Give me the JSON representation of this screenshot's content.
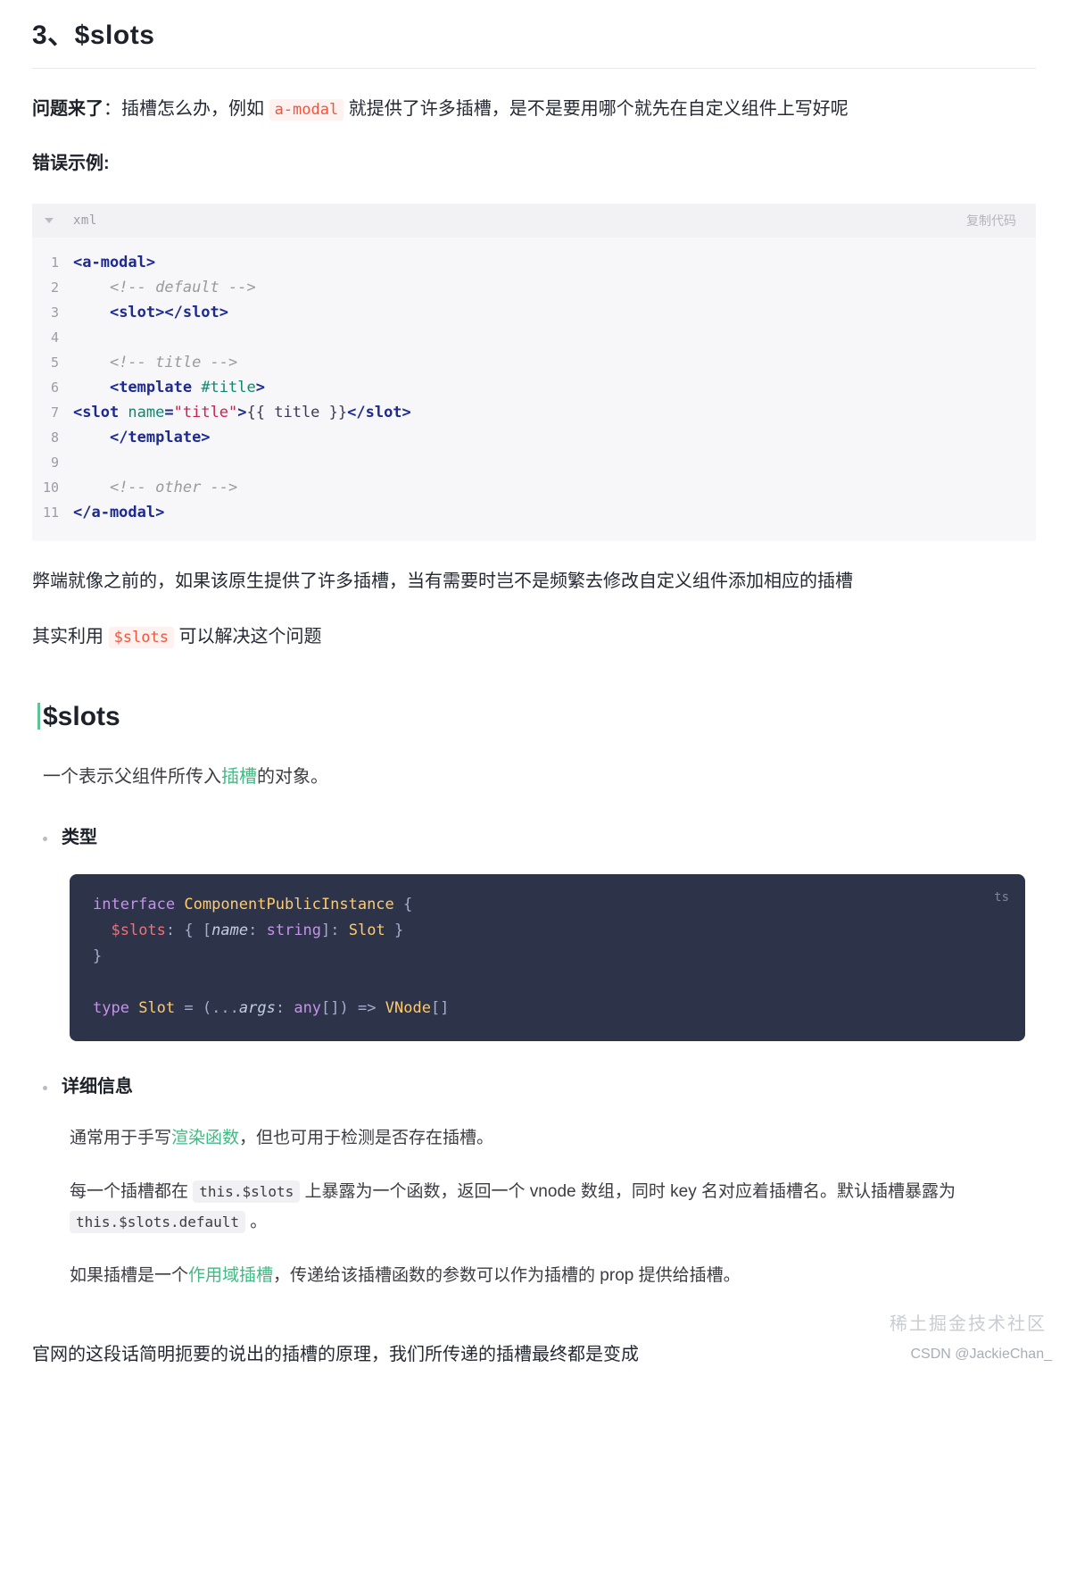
{
  "heading": {
    "title": "3、$slots"
  },
  "intro": {
    "lead_bold": "问题来了",
    "lead_rest_a": "：插槽怎么办，例如 ",
    "inline_code": "a-modal",
    "lead_rest_b": " 就提供了许多插槽，是不是要用哪个就先在自定义组件上写好呢",
    "bad_example_label": "错误示例:"
  },
  "code_xml": {
    "lang": "xml",
    "copy_label": "复制代码",
    "caret_icon": "chevron-down-icon",
    "line_numbers": [
      "1",
      "2",
      "3",
      "4",
      "5",
      "6",
      "7",
      "8",
      "9",
      "10",
      "11"
    ],
    "lines": [
      "<a-modal>",
      "    <!-- default -->",
      "    <slot></slot>",
      "",
      "    <!-- title -->",
      "    <template #title>",
      "<slot name=\"title\">{{ title }}</slot>",
      "    </template>",
      "",
      "    <!-- other -->",
      "</a-modal>"
    ]
  },
  "after_code": {
    "p1": "弊端就像之前的，如果该原生提供了许多插槽，当有需要时岂不是频繁去修改自定义组件添加相应的插槽",
    "p2_a": "其实利用 ",
    "p2_code": "$slots",
    "p2_b": " 可以解决这个问题"
  },
  "docs": {
    "title": "$slots",
    "intro_a": "一个表示父组件所传入",
    "intro_link": "插槽",
    "intro_b": "的对象。",
    "bullet_type": "类型",
    "bullet_detail": "详细信息",
    "code_ts": {
      "lang": "ts",
      "lines": [
        "interface ComponentPublicInstance {",
        "  $slots: { [name: string]: Slot }",
        "}",
        "",
        "type Slot = (...args: any[]) => VNode[]"
      ]
    },
    "detail_p1_a": "通常用于手写",
    "detail_p1_link": "渲染函数",
    "detail_p1_b": "，但也可用于检测是否存在插槽。",
    "detail_p2_a": "每一个插槽都在 ",
    "detail_p2_code1": "this.$slots",
    "detail_p2_b": " 上暴露为一个函数，返回一个 vnode 数组，同时 key 名对应着插槽名。默认插槽暴露为 ",
    "detail_p2_code2": "this.$slots.default",
    "detail_p2_c": " 。",
    "detail_p3_a": "如果插槽是一个",
    "detail_p3_link": "作用域插槽",
    "detail_p3_b": "，传递给该插槽函数的参数可以作为插槽的 prop 提供给插槽。"
  },
  "closing": {
    "text": "官网的这段话简明扼要的说出的插槽的原理，我们所传递的插槽最终都是变成"
  },
  "watermarks": {
    "juejin": "稀土掘金技术社区",
    "csdn": "CSDN @JackieChan_"
  },
  "colors": {
    "accent_green": "#42b883",
    "inline_code": "#f0563d",
    "dark_bg": "#2d3348",
    "light_code_bg": "#f7f7f9"
  }
}
